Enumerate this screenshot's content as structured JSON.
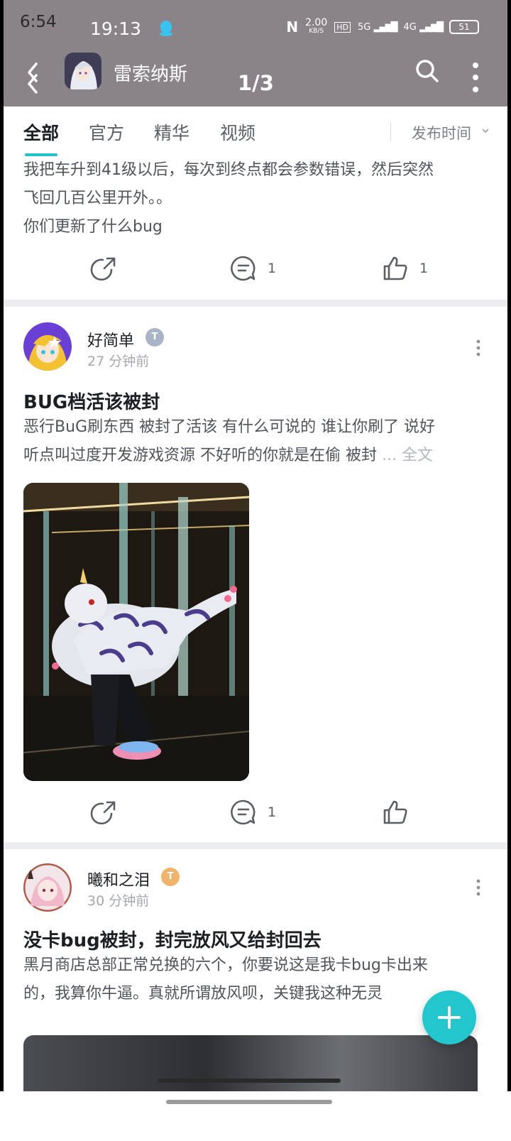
{
  "status_bar": {
    "outer_time": "6:54",
    "inner_time": "19:13",
    "net_speed": "2.00",
    "net_unit": "KB/S",
    "hd_label": "HD",
    "signal_1": "5G",
    "signal_2": "4G",
    "battery": "51"
  },
  "nav": {
    "title": "雷索纳斯",
    "page_indicator": "1/3"
  },
  "tabs": {
    "items": [
      "全部",
      "官方",
      "精华",
      "视频"
    ],
    "sort_label": "发布时间"
  },
  "post1": {
    "body_line1": "我把车升到41级以后，每次到终点都会参数错误，然后突然",
    "body_line2": "飞回几百公里开外。。",
    "body_line3": "你们更新了什么bug",
    "comments": "1",
    "likes": "1"
  },
  "post2": {
    "author": "好简单",
    "badge": "T",
    "time": "27 分钟前",
    "title": "BUG档活该被封",
    "body_line1": "恶行BuG刷东西 被封了活该 有什么可说的 谁让你刷了 说好",
    "body_line2": "听点叫过度开发游戏资源 不好听的你就是在偷 被封",
    "read_more": "... 全文",
    "comments": "1"
  },
  "post3": {
    "author": "曦和之泪",
    "badge": "T",
    "time": "30 分钟前",
    "title": "没卡bug被封，封完放风又给封回去",
    "body_line1": "黑月商店总部正常兑换的六个，你要说这是我卡bug卡出来",
    "body_line2": "的，我算你牛逼。真就所谓放风呗，关键我这种无灵"
  },
  "colors": {
    "accent": "#22c6cd",
    "header": "#8a8489",
    "badge_grey": "#aab4c8",
    "badge_orange": "#f0b36b"
  }
}
